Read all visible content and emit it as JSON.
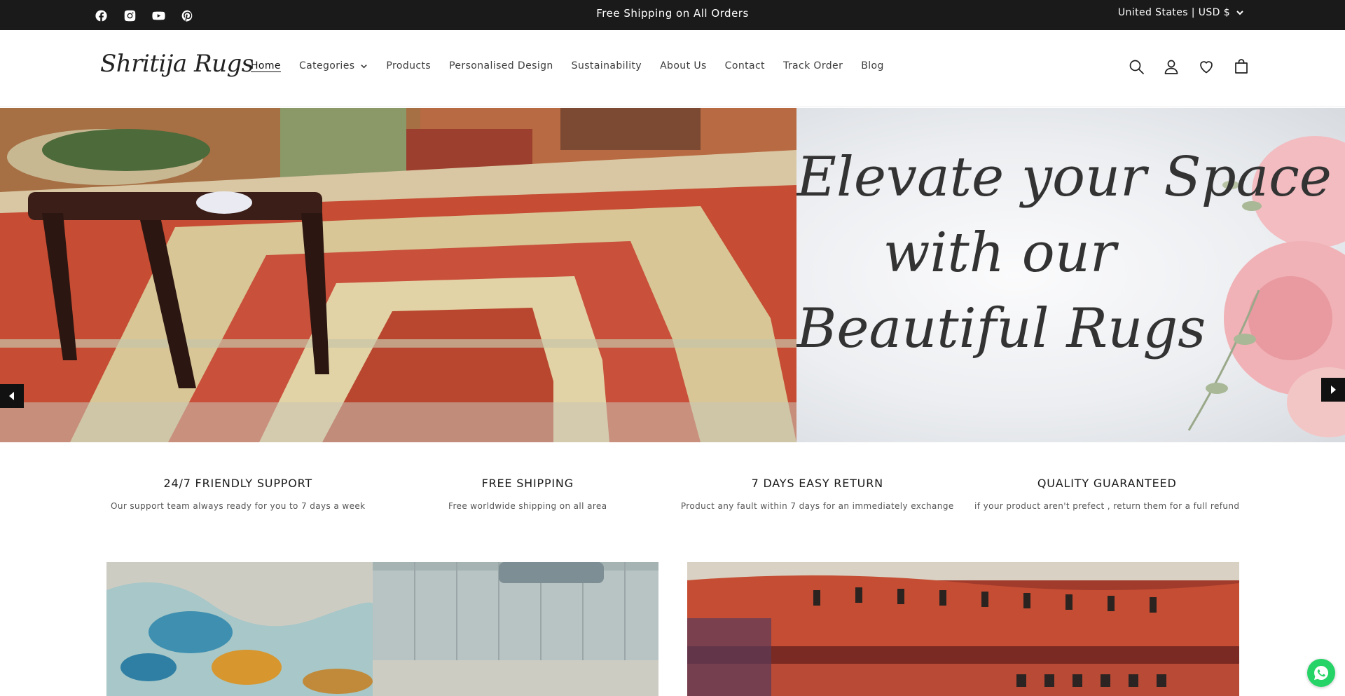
{
  "announcement": {
    "text": "Free Shipping on All Orders",
    "locale": "United States | USD $",
    "socials": [
      "facebook-icon",
      "instagram-icon",
      "youtube-icon",
      "pinterest-icon"
    ]
  },
  "header": {
    "logo": "Shritija Rugs",
    "nav": [
      {
        "label": "Home",
        "active": true
      },
      {
        "label": "Categories",
        "dropdown": true
      },
      {
        "label": "Products"
      },
      {
        "label": "Personalised Design"
      },
      {
        "label": "Sustainability"
      },
      {
        "label": "About Us"
      },
      {
        "label": "Contact"
      },
      {
        "label": "Track Order"
      },
      {
        "label": "Blog"
      }
    ],
    "icons": [
      "search-icon",
      "account-icon",
      "wishlist-icon",
      "cart-icon"
    ]
  },
  "hero": {
    "lines": [
      "Elevate your Space",
      "with our",
      "Beautiful Rugs"
    ]
  },
  "features": [
    {
      "title": "24/7 FRIENDLY SUPPORT",
      "text": "Our support team always ready for you to 7 days a week"
    },
    {
      "title": "FREE SHIPPING",
      "text": "Free worldwide shipping on all area"
    },
    {
      "title": "7 DAYS EASY RETURN",
      "text": "Product any fault within 7 days for an immediately exchange"
    },
    {
      "title": "QUALITY GUARANTEED",
      "text": "if your product aren't prefect , return them for a full refund"
    }
  ],
  "colors": {
    "topbar": "#1a1a1a",
    "rug_red": "#b8492f",
    "whatsapp": "#25d366"
  }
}
